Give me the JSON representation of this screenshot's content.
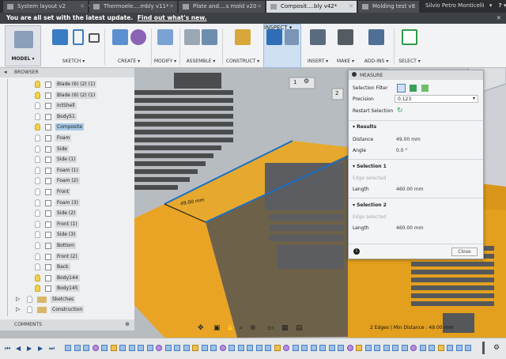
{
  "tabs": [
    {
      "label": "System layout v2",
      "active": false
    },
    {
      "label": "Thermoele....mbly v11*",
      "active": false
    },
    {
      "label": "Plate and....s mold v20",
      "active": false
    },
    {
      "label": "Composit....bly v42*",
      "active": true
    },
    {
      "label": "Molding test v8",
      "active": false
    }
  ],
  "user_name": "Silvio Petro Monticelli",
  "banner": {
    "text": "You are all set with the latest update.",
    "link": "Find out what's new."
  },
  "toolbar": {
    "model": "MODEL",
    "groups": [
      "SKETCH",
      "CREATE",
      "MODIFY",
      "ASSEMBLE",
      "CONSTRUCT",
      "INSPECT",
      "INSERT",
      "MAKE",
      "ADD-INS",
      "SELECT"
    ]
  },
  "browser": {
    "title": "BROWSER",
    "items": [
      {
        "label": "Blade (6) (2) (1)",
        "on": true
      },
      {
        "label": "Blade (6) (2) (1)",
        "on": true
      },
      {
        "label": "IntShell",
        "on": false
      },
      {
        "label": "Body51",
        "on": false
      },
      {
        "label": "Composite",
        "on": true
      },
      {
        "label": "Foam",
        "on": false
      },
      {
        "label": "Side",
        "on": false
      },
      {
        "label": "Side (1)",
        "on": false
      },
      {
        "label": "Foam (1)",
        "on": false
      },
      {
        "label": "Foam (2)",
        "on": false
      },
      {
        "label": "Front",
        "on": false
      },
      {
        "label": "Foam (3)",
        "on": false
      },
      {
        "label": "Side (2)",
        "on": false
      },
      {
        "label": "Front (1)",
        "on": false
      },
      {
        "label": "Side (3)",
        "on": false
      },
      {
        "label": "Bottom",
        "on": false
      },
      {
        "label": "Front (2)",
        "on": false
      },
      {
        "label": "Back",
        "on": false
      },
      {
        "label": "Body144",
        "on": true
      },
      {
        "label": "Body145",
        "on": true
      }
    ],
    "folders": [
      "Sketches",
      "Construction"
    ],
    "comments": "COMMENTS"
  },
  "viewport": {
    "dimension_label": "49.00 mm",
    "marker1": "1",
    "marker2": "2"
  },
  "measure": {
    "title": "MEASURE",
    "selection_filter_label": "Selection Filter",
    "precision_label": "Precision",
    "precision_value": "0.123",
    "restart_label": "Restart Selection",
    "results_title": "Results",
    "distance_label": "Distance",
    "distance_value": "49.00 mm",
    "angle_label": "Angle",
    "angle_value": "0.0 °",
    "sel1_title": "Selection 1",
    "sel1_type": "Edge selected",
    "sel1_length_label": "Length",
    "sel1_length_value": "460.00 mm",
    "sel2_title": "Selection 2",
    "sel2_type": "Edge selected",
    "sel2_length_label": "Length",
    "sel2_length_value": "460.00 mm",
    "close_label": "Close"
  },
  "status": "2 Edges | Min Distance : 49.00 mm",
  "colors": {
    "accent": "#1d6fc4",
    "body": "#e6a92e",
    "dark": "#2b2d30"
  }
}
